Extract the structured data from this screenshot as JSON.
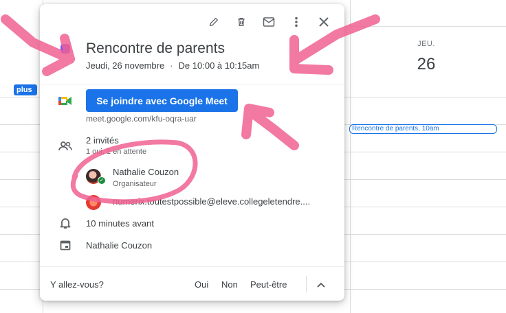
{
  "calendar": {
    "day_name": "JEU.",
    "day_number": "26",
    "more_chip": "plus",
    "event_chip_title": "Rencontre de parents",
    "event_chip_time": ", 10am"
  },
  "toolbar": {
    "edit_icon": "pencil-icon",
    "delete_icon": "trash-icon",
    "email_icon": "mail-icon",
    "more_icon": "more-vert-icon",
    "close_icon": "close-icon"
  },
  "event": {
    "color": "#7c4dff",
    "title": "Rencontre de parents",
    "date": "Jeudi, 26 novembre",
    "separator": "·",
    "time_range": "De 10:00 à 10:15am"
  },
  "meet": {
    "button_label": "Se joindre avec Google Meet",
    "url": "meet.google.com/kfu-oqra-uar"
  },
  "guests": {
    "count_label": "2 invités",
    "status_label": "1 oui, 1 en attente",
    "list": [
      {
        "name": "Nathalie Couzon",
        "role": "Organisateur"
      },
      {
        "name": "numerix.toutestpossible@eleve.collegeletendre....",
        "role": ""
      }
    ]
  },
  "reminder": "10 minutes avant",
  "calendar_owner": "Nathalie Couzon",
  "rsvp": {
    "question": "Y allez-vous?",
    "yes": "Oui",
    "no": "Non",
    "maybe": "Peut-être"
  },
  "annotation_color": "#f06292"
}
